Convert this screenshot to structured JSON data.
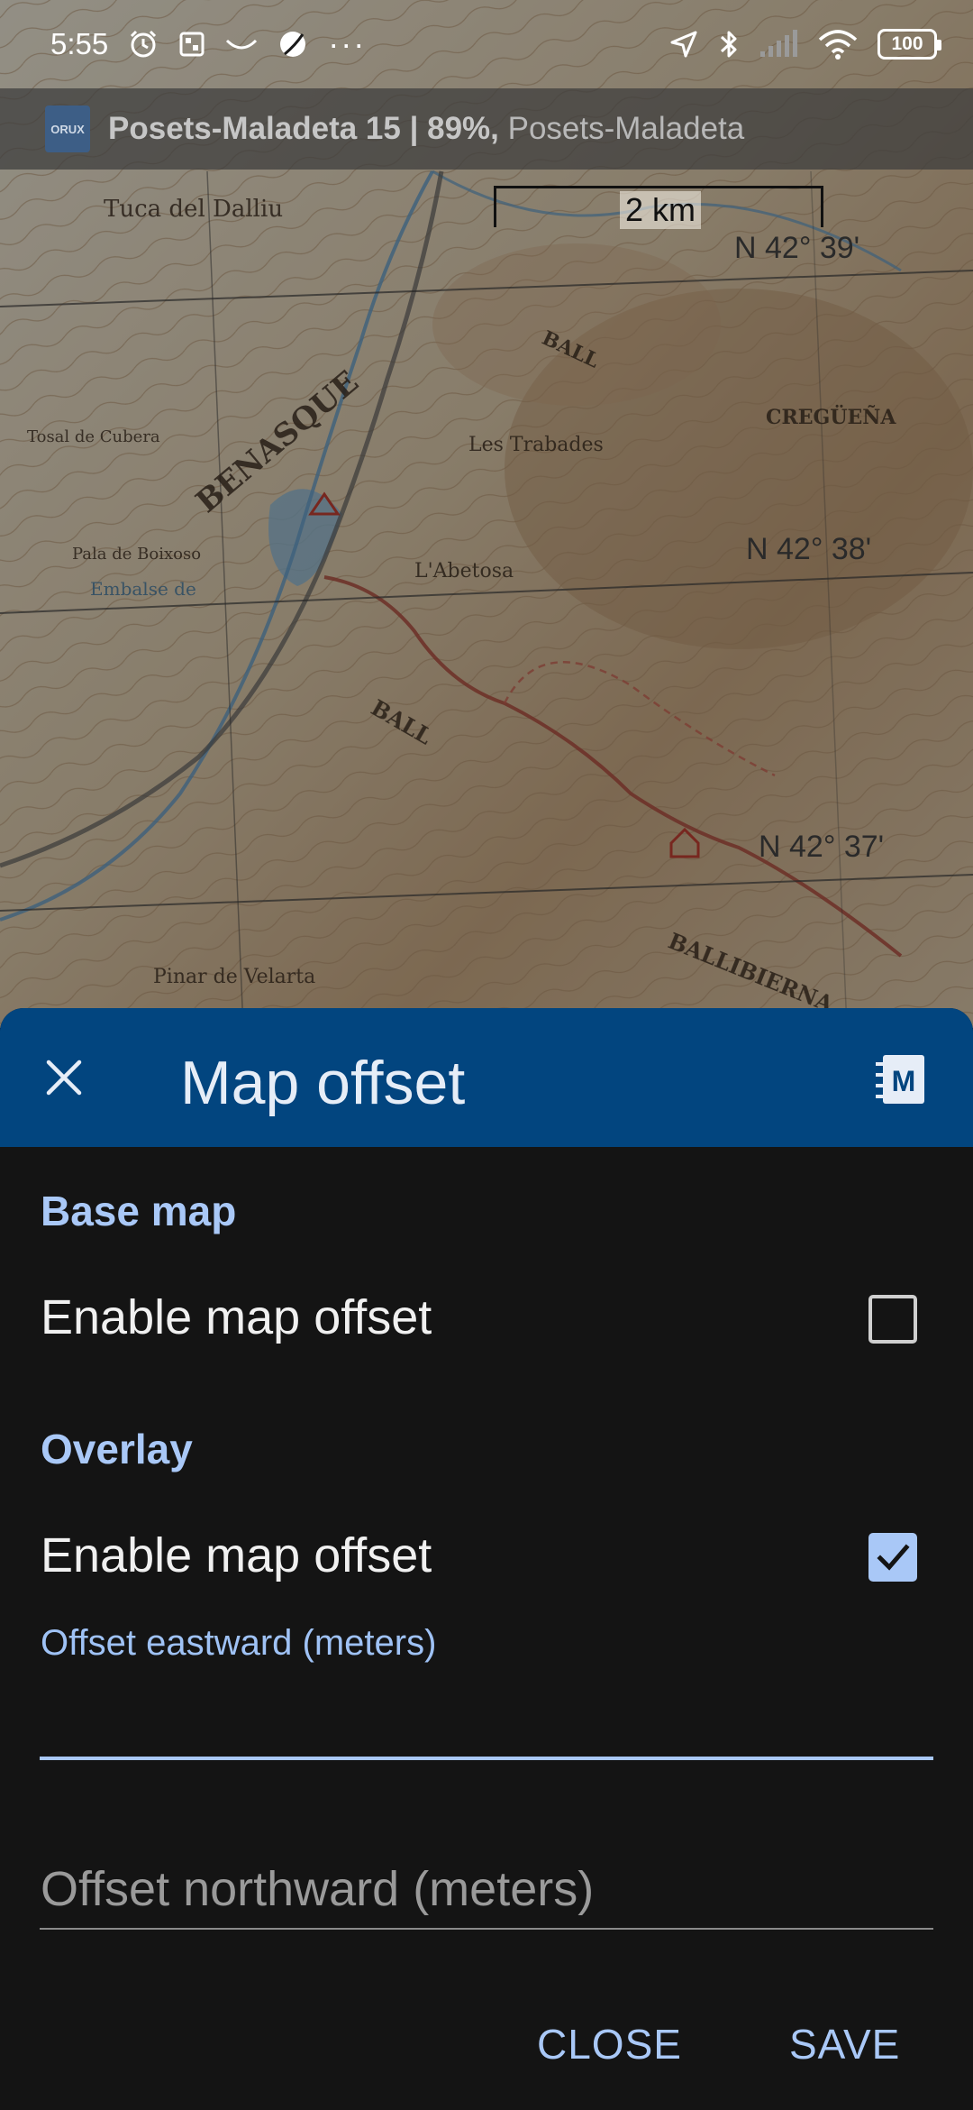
{
  "status_bar": {
    "time": "5:55",
    "left_icons": [
      "alarm-icon",
      "gallery-icon",
      "smile-icon",
      "ball-icon",
      "more-dots-icon"
    ],
    "right_icons": [
      "location-arrow-icon",
      "bluetooth-icon",
      "signal-icon",
      "wifi-icon",
      "battery-icon"
    ],
    "battery_level": "100",
    "more": "···"
  },
  "app_bar": {
    "logo_text": "ORUX",
    "title_bold": "Posets-Maladeta 15 | 89%,",
    "title_rest": " Posets-Maladeta"
  },
  "map": {
    "scale_label": "2 km",
    "coord_labels": [
      "N 42° 39'",
      "N 42° 38'",
      "N 42° 37'"
    ]
  },
  "dialog": {
    "title": "Map offset",
    "base_map": {
      "section_title": "Base map",
      "enable_label": "Enable map offset",
      "enabled": false
    },
    "overlay": {
      "section_title": "Overlay",
      "enable_label": "Enable map offset",
      "enabled": true,
      "offset_east_label": "Offset eastward (meters)",
      "offset_east_value": "",
      "offset_north_placeholder": "Offset northward (meters)",
      "offset_north_value": ""
    },
    "buttons": {
      "close": "CLOSE",
      "save": "SAVE"
    }
  },
  "colors": {
    "header_bg": "#02457f",
    "accent": "#a9c8f7",
    "sheet_bg": "#141414"
  }
}
